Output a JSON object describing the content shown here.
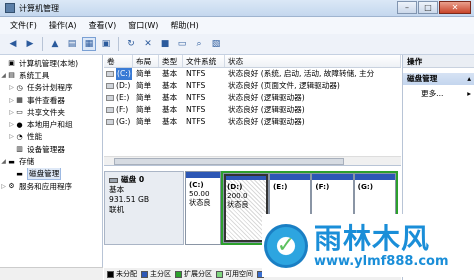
{
  "window": {
    "title": "计算机管理",
    "min": "–",
    "max": "□",
    "close": "✕"
  },
  "menu": [
    "文件(F)",
    "操作(A)",
    "查看(V)",
    "窗口(W)",
    "帮助(H)"
  ],
  "tree": {
    "root": "计算机管理(本地)",
    "system_tools": "系统工具",
    "task_scheduler": "任务计划程序",
    "event_viewer": "事件查看器",
    "shared_folders": "共享文件夹",
    "local_users": "本地用户和组",
    "performance": "性能",
    "device_manager": "设备管理器",
    "storage": "存储",
    "disk_management": "磁盘管理",
    "services": "服务和应用程序"
  },
  "table": {
    "headers": [
      "卷",
      "布局",
      "类型",
      "文件系统",
      "状态"
    ],
    "rows": [
      [
        "(C:)",
        "简单",
        "基本",
        "NTFS",
        "状态良好 (系统, 启动, 活动, 故障转储, 主分"
      ],
      [
        "(D:)",
        "简单",
        "基本",
        "NTFS",
        "状态良好 (页面文件, 逻辑驱动器)"
      ],
      [
        "(E:)",
        "简单",
        "基本",
        "NTFS",
        "状态良好 (逻辑驱动器)"
      ],
      [
        "(F:)",
        "简单",
        "基本",
        "NTFS",
        "状态良好 (逻辑驱动器)"
      ],
      [
        "(G:)",
        "简单",
        "基本",
        "NTFS",
        "状态良好 (逻辑驱动器)"
      ]
    ]
  },
  "disk": {
    "name": "磁盘 0",
    "type": "基本",
    "size": "931.51 GB",
    "status": "联机",
    "partitions": [
      {
        "label": "(C:)",
        "size": "50.00",
        "status": "状态良"
      },
      {
        "label": "(D:)",
        "size": "200.0",
        "status": "状态良"
      },
      {
        "label": "(E:)",
        "size": "",
        "status": ""
      },
      {
        "label": "(F:)",
        "size": "",
        "status": ""
      },
      {
        "label": "(G:)",
        "size": "",
        "status": ""
      }
    ]
  },
  "legend": [
    {
      "label": "未分配",
      "color": "#000000"
    },
    {
      "label": "主分区",
      "color": "#2d57b5"
    },
    {
      "label": "扩展分区",
      "color": "#2ca02c"
    },
    {
      "label": "可用空间",
      "color": "#7fd67f"
    },
    {
      "label": "逻辑驱动器",
      "color": "#3a6fd0"
    }
  ],
  "actions": {
    "header": "操作",
    "section": "磁盘管理",
    "more": "更多..."
  },
  "watermark": {
    "title": "雨林木风",
    "url": "www.ylmf888.com"
  }
}
